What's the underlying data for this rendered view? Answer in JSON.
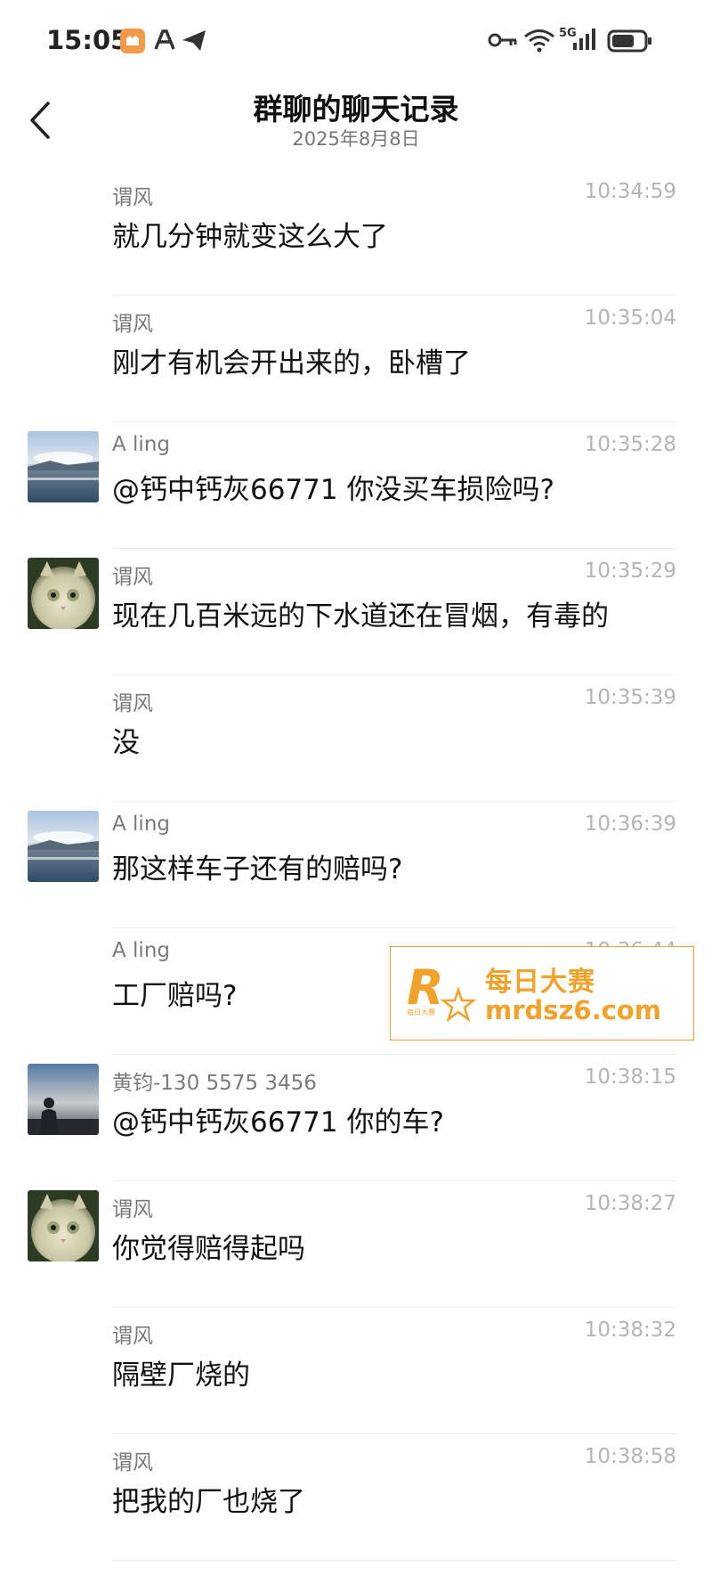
{
  "status_bar": {
    "time": "15:05",
    "network": "5G"
  },
  "header": {
    "title": "群聊的聊天记录",
    "date": "2025年8月8日"
  },
  "messages": [
    {
      "sender": "谓风",
      "time": "10:34:59",
      "text": "就几分钟就变这么大了",
      "avatar": "none"
    },
    {
      "sender": "谓风",
      "time": "10:35:04",
      "text": "刚才有机会开出来的，卧槽了",
      "avatar": "none"
    },
    {
      "sender": "A ling",
      "time": "10:35:28",
      "text": "@钙中钙灰66771 你没买车损险吗?",
      "avatar": "lake"
    },
    {
      "sender": "谓风",
      "time": "10:35:29",
      "text": "现在几百米远的下水道还在冒烟，有毒的",
      "avatar": "cat"
    },
    {
      "sender": "谓风",
      "time": "10:35:39",
      "text": "没",
      "avatar": "none"
    },
    {
      "sender": "A ling",
      "time": "10:36:39",
      "text": "那这样车子还有的赔吗?",
      "avatar": "lake"
    },
    {
      "sender": "A ling",
      "time": "10:36:44",
      "text": "工厂赔吗?",
      "avatar": "none"
    },
    {
      "sender": "黄钧-130 5575 3456",
      "time": "10:38:15",
      "text": "@钙中钙灰66771 你的车?",
      "avatar": "person"
    },
    {
      "sender": "谓风",
      "time": "10:38:27",
      "text": "你觉得赔得起吗",
      "avatar": "cat"
    },
    {
      "sender": "谓风",
      "time": "10:38:32",
      "text": "隔壁厂烧的",
      "avatar": "none"
    },
    {
      "sender": "谓风",
      "time": "10:38:58",
      "text": "把我的厂也烧了",
      "avatar": "none"
    }
  ],
  "watermark": {
    "brand": "每日大赛",
    "url": "mrdsz6.com",
    "logo_letter": "R",
    "logo_small": "每日大赛"
  },
  "colors": {
    "accent": "#f0a22a",
    "muted": "#7a7a7a",
    "time": "#b4b4b4"
  }
}
